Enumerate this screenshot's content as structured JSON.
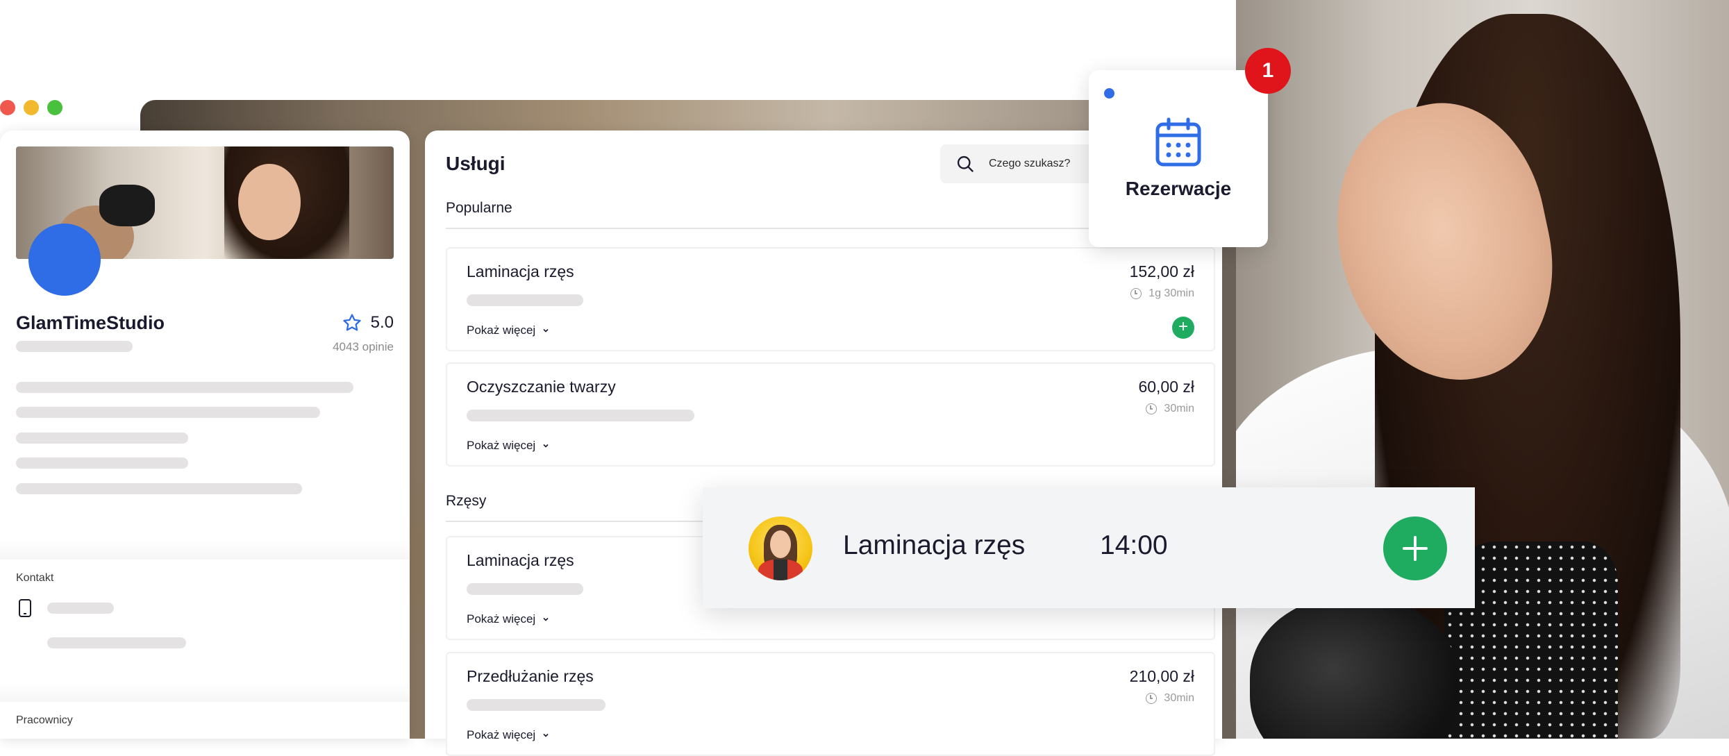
{
  "window_controls": [
    "close",
    "minimize",
    "maximize"
  ],
  "profile": {
    "name": "GlamTimeStudio",
    "rating": "5.0",
    "reviews": "4043 opinie",
    "contact_label": "Kontakt",
    "employees_label": "Pracownicy"
  },
  "services": {
    "title": "Usługi",
    "search_placeholder": "Czego szukasz?",
    "categories": [
      {
        "label": "Popularne",
        "items": [
          {
            "name": "Laminacja rzęs",
            "price": "152,00 zł",
            "duration": "1g 30min",
            "more": "Pokaż więcej"
          },
          {
            "name": "Oczyszczanie twarzy",
            "price": "60,00 zł",
            "duration": "30min",
            "more": "Pokaż więcej"
          }
        ]
      },
      {
        "label": "Rzęsy",
        "items": [
          {
            "name": "Laminacja rzęs",
            "more": "Pokaż więcej"
          },
          {
            "name": "Przedłużanie rzęs",
            "price": "210,00 zł",
            "duration": "30min",
            "more": "Pokaż więcej"
          }
        ]
      }
    ]
  },
  "reservations": {
    "label": "Rezerwacje",
    "badge_count": "1"
  },
  "booking": {
    "service": "Laminacja rzęs",
    "time": "14:00"
  },
  "colors": {
    "accent_blue": "#2f6de6",
    "accent_green": "#1fac61",
    "badge_red": "#e0141b"
  }
}
